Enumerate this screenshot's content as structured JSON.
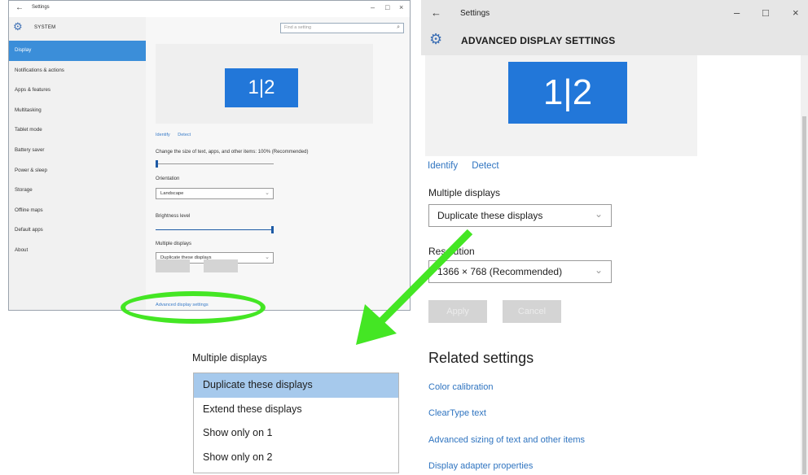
{
  "left_window": {
    "title": "Settings",
    "back_glyph": "←",
    "controls": [
      "–",
      "□",
      "×"
    ],
    "section": "SYSTEM",
    "search_placeholder": "Find a setting",
    "nav": [
      "Display",
      "Notifications & actions",
      "Apps & features",
      "Multitasking",
      "Tablet mode",
      "Battery saver",
      "Power & sleep",
      "Storage",
      "Offline maps",
      "Default apps",
      "About"
    ],
    "selected_nav": "Display",
    "monitor_label": "1|2",
    "identify": "Identify",
    "detect": "Detect",
    "scale_label": "Change the size of text, apps, and other items: 100% (Recommended)",
    "scale_value_percent": 100,
    "orientation_label": "Orientation",
    "orientation_value": "Landscape",
    "brightness_label": "Brightness level",
    "brightness_fraction": 1.0,
    "multiple_displays_label": "Multiple displays",
    "multiple_displays_value": "Duplicate these displays",
    "advanced_link": "Advanced display settings"
  },
  "right_window": {
    "title": "Settings",
    "back_glyph": "←",
    "controls": [
      "–",
      "□",
      "×"
    ],
    "heading": "ADVANCED DISPLAY SETTINGS",
    "monitor_label": "1|2",
    "identify": "Identify",
    "detect": "Detect",
    "multiple_displays_label": "Multiple displays",
    "multiple_displays_value": "Duplicate these displays",
    "resolution_label": "Resolution",
    "resolution_value": "1366 × 768 (Recommended)",
    "apply_label": "Apply",
    "cancel_label": "Cancel",
    "related_heading": "Related settings",
    "related_links": [
      "Color calibration",
      "ClearType text",
      "Advanced sizing of text and other items",
      "Display adapter properties"
    ]
  },
  "dropdown": {
    "label": "Multiple displays",
    "options": [
      "Duplicate these displays",
      "Extend these displays",
      "Show only on 1",
      "Show only on 2"
    ],
    "selected": "Duplicate these displays"
  },
  "icons": {
    "gear": "gear-icon",
    "chevron": "chevron-down-icon",
    "search": "search-icon"
  },
  "colors": {
    "accent": "#3b8ed9",
    "monitor": "#2277d9",
    "highlight_ellipse": "#44e624",
    "link": "#2f74c0",
    "dropdown_selected": "#a6c9ec"
  }
}
